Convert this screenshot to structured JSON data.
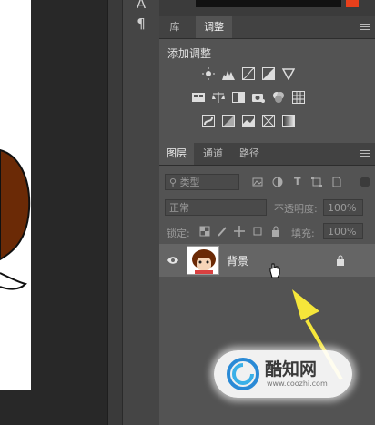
{
  "tools": {
    "type_icon": "A",
    "paragraph_icon": "¶"
  },
  "top_panel": {
    "tabs": [
      {
        "label": "库"
      },
      {
        "label": "调整"
      }
    ],
    "active_tab": "调整",
    "add_adjustment_label": "添加调整"
  },
  "layers_panel": {
    "tabs": [
      {
        "label": "图层"
      },
      {
        "label": "通道"
      },
      {
        "label": "路径"
      }
    ],
    "filter_kind": "类型",
    "blend_mode": "正常",
    "opacity_label": "不透明度:",
    "opacity_value": "100%",
    "lock_label": "锁定:",
    "fill_label": "填充:",
    "fill_value": "100%",
    "layers": [
      {
        "name": "背景",
        "visible": true,
        "locked": true
      }
    ]
  },
  "watermark": {
    "brand": "酷知网",
    "url": "www.coozhi.com"
  },
  "colors": {
    "panel_bg": "#535353",
    "tab_bar": "#424242",
    "layer_selected": "#656565",
    "accent_red": "#e8401c",
    "arrow_yellow": "#f5e63a"
  }
}
